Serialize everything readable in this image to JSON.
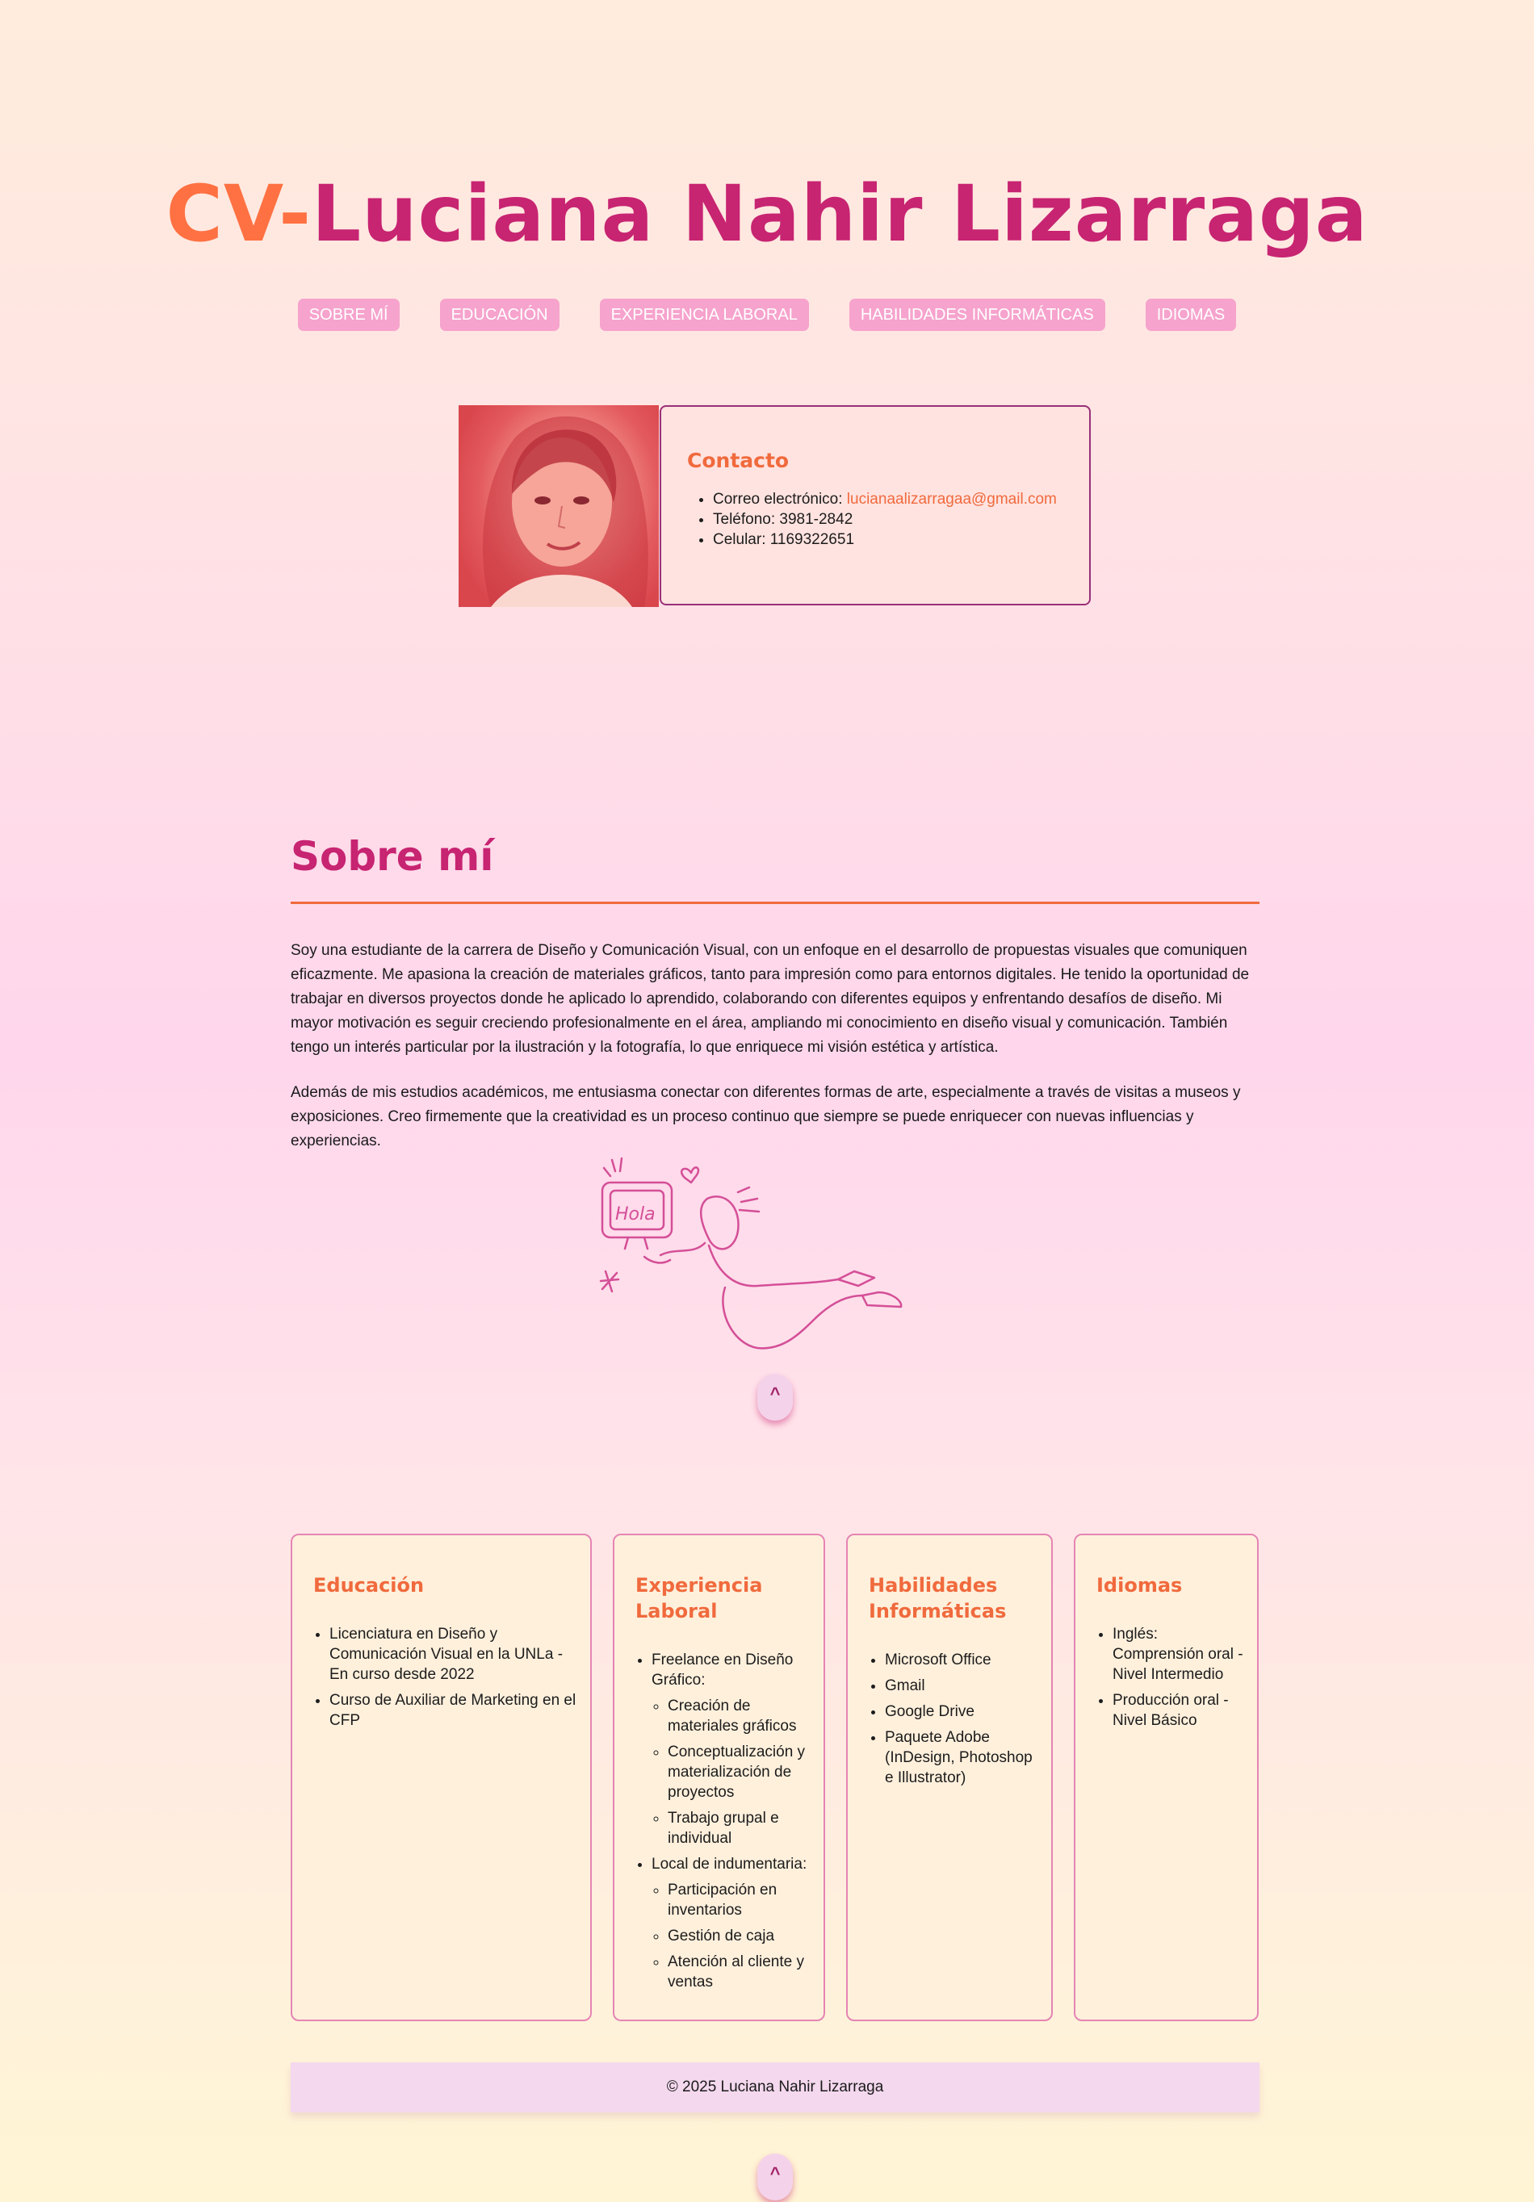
{
  "header": {
    "title_prefix": "CV-",
    "title_name": "Luciana Nahir Lizarraga"
  },
  "nav": {
    "items": [
      "SOBRE MÍ",
      "EDUCACIÓN",
      "EXPERIENCIA LABORAL",
      "HABILIDADES INFORMÁTICAS",
      "IDIOMAS"
    ]
  },
  "contact": {
    "heading": "Contacto",
    "email_label": "Correo electrónico: ",
    "email": "lucianaalizarragaa@gmail.com",
    "phone": "Teléfono: 3981-2842",
    "mobile": "Celular: 1169322651"
  },
  "about": {
    "heading": "Sobre mí",
    "p1": "Soy una estudiante de la carrera de Diseño y Comunicación Visual, con un enfoque en el desarrollo de propuestas visuales que comuniquen eficazmente. Me apasiona la creación de materiales gráficos, tanto para impresión como para entornos digitales. He tenido la oportunidad de trabajar en diversos proyectos donde he aplicado lo aprendido, colaborando con diferentes equipos y enfrentando desafíos de diseño. Mi mayor motivación es seguir creciendo profesionalmente en el área, ampliando mi conocimiento en diseño visual y comunicación. También tengo un interés particular por la ilustración y la fotografía, lo que enriquece mi visión estética y artística.",
    "p2": "Además de mis estudios académicos, me entusiasma conectar con diferentes formas de arte, especialmente a través de visitas a museos y exposiciones. Creo firmemente que la creatividad es un proceso continuo que siempre se puede enriquecer con nuevas influencias y experiencias.",
    "drawing_text": "Hola"
  },
  "back_to_top": "^",
  "cards": {
    "education": {
      "heading": "Educación",
      "items": [
        "Licenciatura en Diseño y Comunicación Visual en la UNLa - En curso desde 2022",
        "Curso de Auxiliar de Marketing en el CFP"
      ]
    },
    "experience": {
      "heading": "Experiencia Laboral",
      "job1": "Freelance en Diseño Gráfico:",
      "job1_tasks": [
        "Creación de materiales gráficos",
        "Conceptualización y materialización de proyectos",
        "Trabajo grupal e individual"
      ],
      "job2": "Local de indumentaria:",
      "job2_tasks": [
        "Participación en inventarios",
        "Gestión de caja",
        "Atención al cliente y ventas"
      ]
    },
    "skills": {
      "heading": "Habilidades Informáticas",
      "items": [
        "Microsoft Office",
        "Gmail",
        "Google Drive",
        "Paquete Adobe (InDesign, Photoshop e Illustrator)"
      ]
    },
    "languages": {
      "heading": "Idiomas",
      "items": [
        "Inglés: Comprensión oral - Nivel Intermedio",
        "Producción oral - Nivel Básico"
      ]
    }
  },
  "footer": {
    "text": "© 2025 Luciana Nahir Lizarraga"
  },
  "colors": {
    "accent_orange": "#f06a3d",
    "accent_magenta": "#c72472",
    "nav_pink": "#f6a3cd"
  }
}
